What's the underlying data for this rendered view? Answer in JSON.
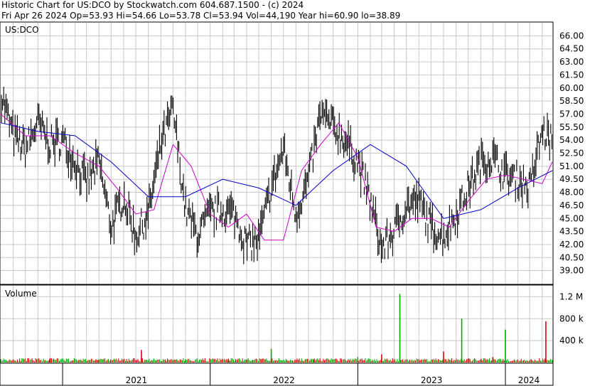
{
  "header": {
    "line1": "Historic Chart for US:DCO by Stockwatch.com 604.687.1500 - (c) 2024",
    "line2": "Fri Apr 26 2024  Op=53.93  Hi=54.66  Lo=53.78  Cl=53.94  Vol=44,190  Year hi=60.90  lo=38.89"
  },
  "colors": {
    "price": "#000000",
    "ma_short": "#cc00cc",
    "ma_long": "#0000cc",
    "vol_up": "#00aa00",
    "vol_down": "#dd0000",
    "grid": "#c8c8c8"
  },
  "chart_data": [
    {
      "type": "line",
      "title": "US:DCO",
      "x_range": [
        "2020-08-01",
        "2024-04-26"
      ],
      "ylim": [
        37.5,
        67.5
      ],
      "y_ticks": [
        "66.00",
        "64.50",
        "63.00",
        "61.50",
        "60.00",
        "58.50",
        "57.00",
        "55.50",
        "54.00",
        "52.50",
        "51.00",
        "49.50",
        "48.00",
        "46.50",
        "45.00",
        "43.50",
        "42.00",
        "40.50",
        "39.00"
      ],
      "x_ticks": [
        "2021",
        "2022",
        "2023",
        "2024"
      ],
      "x_tick_dates": [
        "2021-01-01",
        "2022-01-01",
        "2023-01-01",
        "2024-01-01"
      ],
      "grid": true,
      "series": [
        {
          "style": "price-bars",
          "x": [
            "2020-08-01",
            "2020-09-01",
            "2020-10-01",
            "2020-11-01",
            "2020-12-01",
            "2021-01-01",
            "2021-02-01",
            "2021-03-01",
            "2021-04-01",
            "2021-05-01",
            "2021-06-01",
            "2021-07-01",
            "2021-08-01",
            "2021-09-01",
            "2021-10-01",
            "2021-11-01",
            "2021-12-01",
            "2022-01-01",
            "2022-02-01",
            "2022-03-01",
            "2022-04-01",
            "2022-05-01",
            "2022-06-01",
            "2022-07-01",
            "2022-08-01",
            "2022-09-01",
            "2022-10-01",
            "2022-11-01",
            "2022-12-01",
            "2023-01-01",
            "2023-02-01",
            "2023-03-01",
            "2023-04-01",
            "2023-05-01",
            "2023-06-01",
            "2023-07-01",
            "2023-08-01",
            "2023-09-01",
            "2023-10-01",
            "2023-11-01",
            "2023-12-01",
            "2024-01-01",
            "2024-02-01",
            "2024-03-01",
            "2024-04-01",
            "2024-04-26"
          ],
          "values": [
            59.5,
            54.5,
            53.0,
            56.0,
            53.5,
            54.0,
            51.5,
            49.0,
            51.5,
            44.0,
            47.5,
            43.0,
            45.5,
            53.5,
            57.5,
            46.0,
            43.0,
            45.5,
            46.0,
            45.5,
            42.0,
            42.5,
            48.5,
            53.0,
            45.5,
            49.5,
            57.0,
            55.5,
            54.0,
            51.5,
            47.0,
            41.5,
            43.5,
            46.5,
            47.0,
            44.0,
            43.0,
            45.5,
            48.5,
            51.5,
            52.0,
            50.0,
            49.5,
            48.5,
            55.0,
            53.94
          ]
        },
        {
          "style": "moving-average-short",
          "x": [
            "2020-08-01",
            "2020-10-01",
            "2020-12-01",
            "2021-02-01",
            "2021-04-01",
            "2021-05-15",
            "2021-07-01",
            "2021-08-15",
            "2021-10-01",
            "2021-11-15",
            "2022-01-01",
            "2022-02-15",
            "2022-04-01",
            "2022-05-15",
            "2022-07-01",
            "2022-08-15",
            "2022-10-01",
            "2022-11-15",
            "2023-01-01",
            "2023-02-15",
            "2023-04-01",
            "2023-05-15",
            "2023-07-01",
            "2023-08-15",
            "2023-10-01",
            "2023-11-15",
            "2024-01-01",
            "2024-02-15",
            "2024-04-01",
            "2024-04-26"
          ],
          "values": [
            57.0,
            54.5,
            54.5,
            52.5,
            51.0,
            48.5,
            45.5,
            46.0,
            53.5,
            51.0,
            45.5,
            44.0,
            45.5,
            42.5,
            42.5,
            50.5,
            53.5,
            56.0,
            52.0,
            44.0,
            43.5,
            45.0,
            45.0,
            44.0,
            47.0,
            49.5,
            50.0,
            49.5,
            49.0,
            51.5
          ]
        },
        {
          "style": "moving-average-long",
          "x": [
            "2020-08-01",
            "2020-11-01",
            "2021-02-01",
            "2021-05-01",
            "2021-08-01",
            "2021-11-01",
            "2022-02-01",
            "2022-05-01",
            "2022-08-01",
            "2022-11-01",
            "2023-02-01",
            "2023-05-01",
            "2023-08-01",
            "2023-11-01",
            "2024-02-01",
            "2024-04-26"
          ],
          "values": [
            56.0,
            55.0,
            54.5,
            51.5,
            47.5,
            47.5,
            49.5,
            48.5,
            46.5,
            50.5,
            53.5,
            51.0,
            45.0,
            46.0,
            48.5,
            50.5
          ]
        }
      ]
    },
    {
      "type": "bar",
      "title": "Volume",
      "ylim": [
        0,
        1400000
      ],
      "y_ticks": [
        "400 k",
        "800 k",
        "1.2 M"
      ],
      "y_tick_values": [
        400000,
        800000,
        1200000
      ],
      "grid": true,
      "series": [
        {
          "name": "Volume",
          "x": [
            "2020-08-01",
            "2020-12-01",
            "2021-04-01",
            "2021-07-15",
            "2021-11-01",
            "2022-02-15",
            "2022-06-01",
            "2022-09-15",
            "2023-01-01",
            "2023-03-01",
            "2023-04-15",
            "2023-08-01",
            "2023-09-15",
            "2023-12-01",
            "2024-01-01",
            "2024-04-10",
            "2024-04-26"
          ],
          "values": [
            60000,
            80000,
            55000,
            230000,
            60000,
            70000,
            250000,
            70000,
            100000,
            150000,
            1250000,
            200000,
            800000,
            100000,
            600000,
            750000,
            44190
          ]
        }
      ]
    }
  ]
}
